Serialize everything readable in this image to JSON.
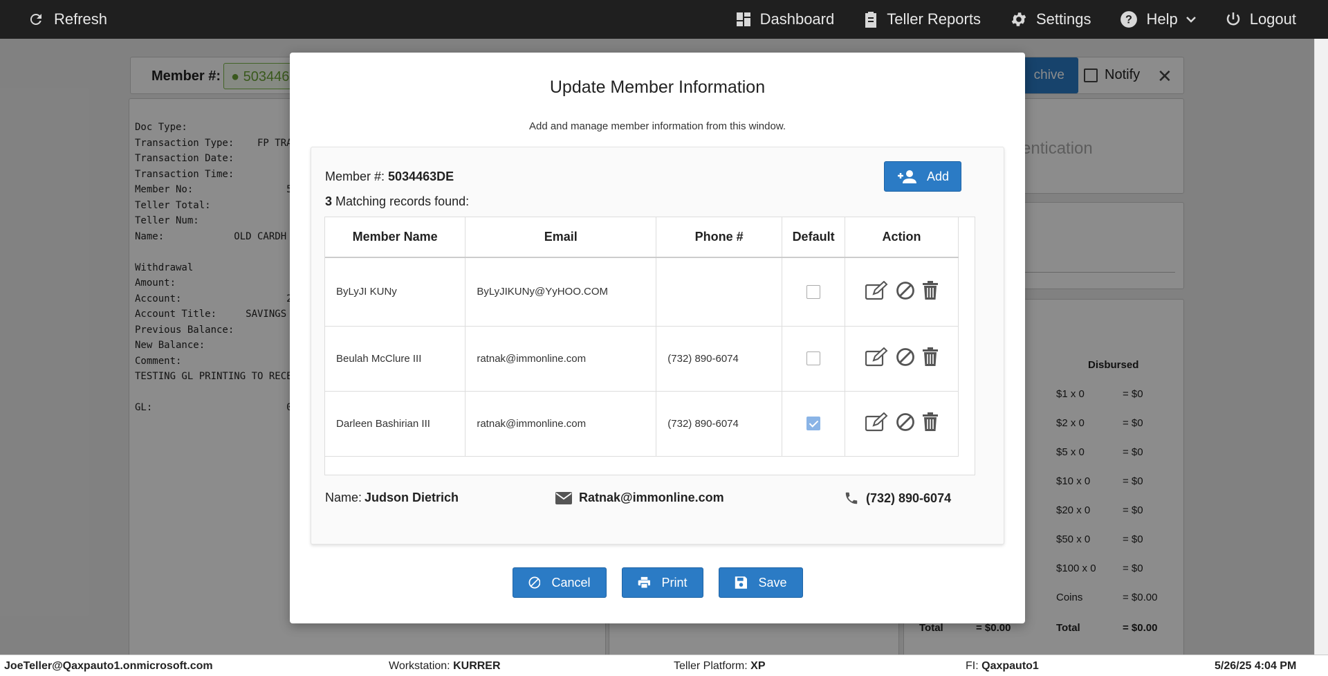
{
  "topbar": {
    "refresh": "Refresh",
    "nav": [
      "Dashboard",
      "Teller Reports",
      "Settings",
      "Help",
      "Logout"
    ]
  },
  "member_bar": {
    "label": "Member #:",
    "value": "503446",
    "archive": "chive",
    "notify": "Notify"
  },
  "receipt": {
    "lines": [
      "Doc Type:",
      "Transaction Type:    FP TRA",
      "Transaction Date:",
      "Transaction Time:",
      "Member No:                5",
      "Teller Total:",
      "Teller Num:",
      "Name:            OLD CARDH",
      "",
      "Withdrawal",
      "Amount:",
      "Account:                  2",
      "Account Title:     SAVINGS",
      "Previous Balance:",
      "New Balance:",
      "Comment:",
      "TESTING GL PRINTING TO RECE",
      "",
      "GL:                       0"
    ]
  },
  "auth": {
    "text": "entication"
  },
  "cash": {
    "disbursed_header": "Disbursed",
    "rows": [
      {
        "denom": "$1 x 0",
        "amount": "= $0"
      },
      {
        "denom": "$2 x 0",
        "amount": "= $0"
      },
      {
        "denom": "$5 x 0",
        "amount": "= $0"
      },
      {
        "denom": "$10 x 0",
        "amount": "= $0"
      },
      {
        "denom": "$20 x 0",
        "amount": "= $0"
      },
      {
        "denom": "$50 x 0",
        "amount": "= $0"
      },
      {
        "denom": "$100 x 0",
        "amount": "= $0"
      },
      {
        "denom": "Coins",
        "amount": "= $0.00"
      }
    ],
    "total_left_label": "Total",
    "total_left_value": "= $0.00",
    "total_right_label": "Total",
    "total_right_value": "= $0.00"
  },
  "modal": {
    "title": "Update Member Information",
    "subtitle": "Add and manage member information from this window.",
    "member_label": "Member #:",
    "member_value": "5034463DE",
    "records_count": "3",
    "records_text": "Matching records found:",
    "add_label": "Add",
    "columns": [
      "Member Name",
      "Email",
      "Phone #",
      "Default",
      "Action"
    ],
    "rows": [
      {
        "name": "ByLyJI KUNy",
        "email": "ByLyJIKUNy@YyHOO.COM",
        "phone": "",
        "default": false
      },
      {
        "name": "Beulah McClure III",
        "email": "ratnak@immonline.com",
        "phone": "(732) 890-6074",
        "default": false
      },
      {
        "name": "Darleen Bashirian III",
        "email": "ratnak@immonline.com",
        "phone": "(732) 890-6074",
        "default": true
      }
    ],
    "footer": {
      "name_label": "Name:",
      "name_value": "Judson Dietrich",
      "email": "Ratnak@immonline.com",
      "phone": "(732) 890-6074"
    },
    "buttons": {
      "cancel": "Cancel",
      "print": "Print",
      "save": "Save"
    }
  },
  "statusbar": {
    "user": "JoeTeller@Qaxpauto1.onmicrosoft.com",
    "workstation_label": "Workstation:",
    "workstation_value": "KURRER",
    "platform_label": "Teller Platform:",
    "platform_value": "XP",
    "fi_label": "FI:",
    "fi_value": "Qaxpauto1",
    "datetime": "5/26/25 4:04 PM"
  }
}
